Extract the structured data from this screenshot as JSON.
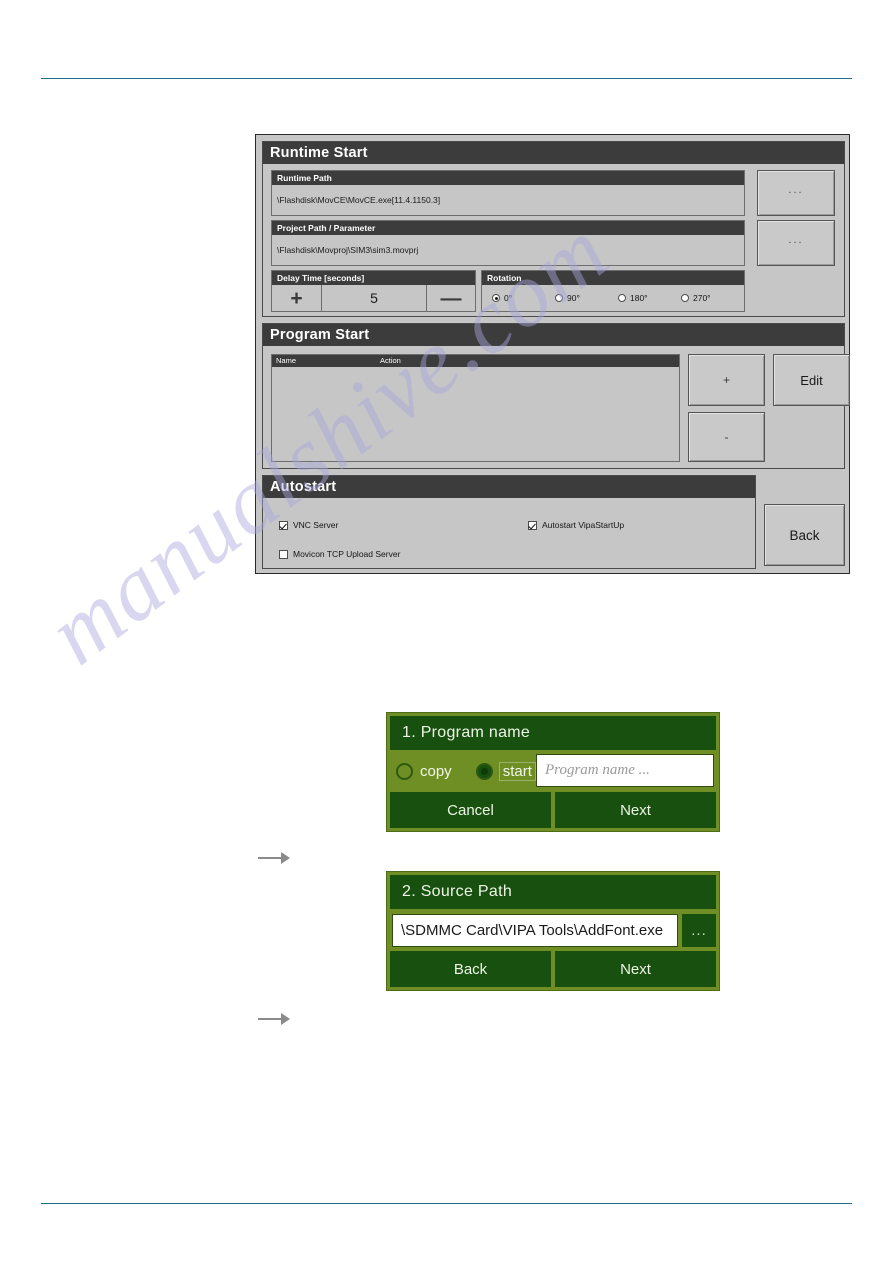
{
  "page": {
    "rule_color": "#1c6e8c",
    "watermark_text": "manualshive.com"
  },
  "runtime_start": {
    "title": "Runtime Start",
    "runtime_path": {
      "label": "Runtime Path",
      "value": "\\Flashdisk\\MovCE\\MovCE.exe[11.4.1150.3]",
      "browse_label": "..."
    },
    "project_path": {
      "label": "Project Path / Parameter",
      "value": "\\Flashdisk\\Movproj\\SIM3\\sim3.movprj",
      "browse_label": "..."
    },
    "delay_time": {
      "label": "Delay Time [seconds]",
      "increment_label": "+",
      "value": "5",
      "decrement_label": "—"
    },
    "rotation": {
      "label": "Rotation",
      "options": [
        {
          "label": "0°",
          "selected": true
        },
        {
          "label": "90°",
          "selected": false
        },
        {
          "label": "180°",
          "selected": false
        },
        {
          "label": "270°",
          "selected": false
        }
      ]
    }
  },
  "program_start": {
    "title": "Program Start",
    "columns": [
      "Name",
      "Action"
    ],
    "rows": [],
    "add_label": "+",
    "remove_label": "-",
    "edit_label": "Edit"
  },
  "autostart": {
    "title": "Autostart",
    "checkboxes": [
      {
        "label": "VNC Server",
        "checked": true
      },
      {
        "label": "Autostart VipaStartUp",
        "checked": true
      },
      {
        "label": "Movicon TCP Upload Server",
        "checked": false
      }
    ],
    "back_label": "Back"
  },
  "dialog_program_name": {
    "title": "1. Program name",
    "options": [
      {
        "label": "copy",
        "selected": false
      },
      {
        "label": "start",
        "selected": true
      }
    ],
    "input_placeholder": "Program name ...",
    "cancel_label": "Cancel",
    "next_label": "Next"
  },
  "dialog_source_path": {
    "title": "2. Source Path",
    "input_value": "\\SDMMC Card\\VIPA Tools\\AddFont.exe",
    "browse_label": "...",
    "back_label": "Back",
    "next_label": "Next"
  }
}
